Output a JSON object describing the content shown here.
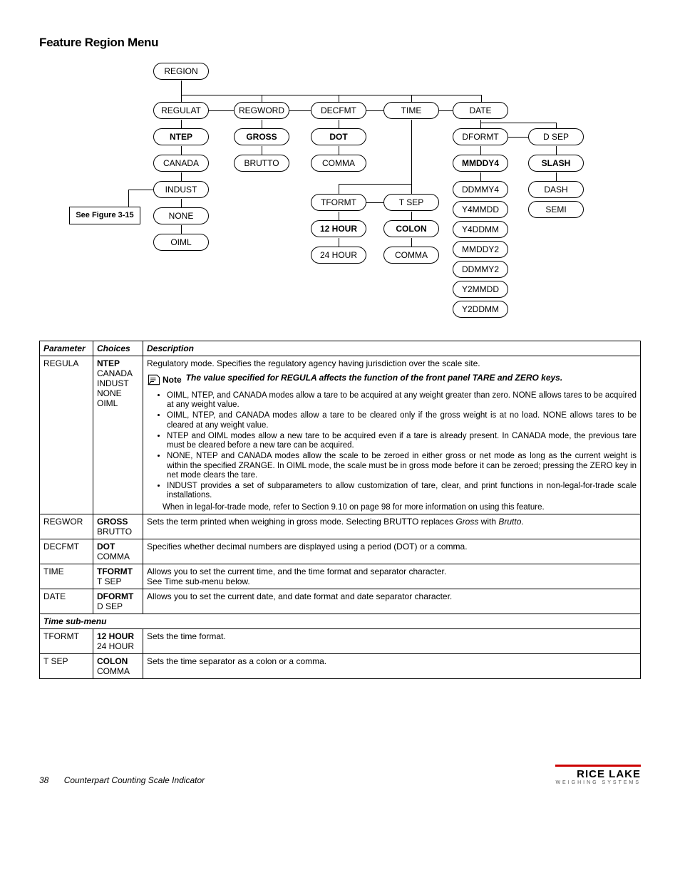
{
  "title": "Feature Region Menu",
  "figref": "See Figure 3-15",
  "diagram": {
    "root": "REGION",
    "row2": [
      "REGULAT",
      "REGWORD",
      "DECFMT",
      "TIME",
      "DATE"
    ],
    "regulat": {
      "sel": "NTEP",
      "opts": [
        "CANADA",
        "INDUST",
        "NONE",
        "OIML"
      ]
    },
    "regword": {
      "sel": "GROSS",
      "opts": [
        "BRUTTO"
      ]
    },
    "decfmt": {
      "sel": "DOT",
      "opts": [
        "COMMA"
      ]
    },
    "time_sub": {
      "t": "TFORMT",
      "s": "T SEP",
      "tformt": {
        "sel": "12 HOUR",
        "opts": [
          "24 HOUR"
        ]
      },
      "tsep": {
        "sel": "COLON",
        "opts": [
          "COMMA"
        ]
      }
    },
    "date_sub": {
      "d": "DFORMT",
      "s": "D SEP",
      "dformt": {
        "sel": "MMDDY4",
        "opts": [
          "DDMMY4",
          "Y4MMDD",
          "Y4DDMM",
          "MMDDY2",
          "DDMMY2",
          "Y2MMDD",
          "Y2DDMM"
        ]
      },
      "dsep": {
        "sel": "SLASH",
        "opts": [
          "DASH",
          "SEMI"
        ]
      }
    }
  },
  "table": {
    "headers": [
      "Parameter",
      "Choices",
      "Description"
    ],
    "rows": [
      {
        "param": "REGULA",
        "choices_bold": "NTEP",
        "choices": [
          "CANADA",
          "INDUST",
          "NONE",
          "OIML"
        ],
        "desc_lead": "Regulatory mode. Specifies the regulatory agency having jurisdiction over the scale site.",
        "note": "The value specified for REGULA affects the function of the front panel TARE and ZERO keys.",
        "bullets": [
          "OIML, NTEP, and CANADA modes allow a tare to be acquired at any weight greater than zero. NONE allows tares to be acquired at any weight value.",
          "OIML, NTEP, and CANADA modes allow a tare to be cleared only if the gross weight is at no load. NONE allows tares to be cleared at any weight value.",
          "NTEP and OIML modes allow a new tare to be acquired even if a tare is already present. In CANADA mode, the previous tare must be cleared before a new tare can be acquired.",
          "NONE, NTEP and CANADA modes allow the scale to be zeroed in either gross or net mode as long as the current weight is within the specified ZRANGE. In OIML mode, the scale must be in gross mode before it can be zeroed; pressing the ZERO key in net mode clears the tare.",
          "INDUST provides a set of subparameters to allow customization of tare, clear, and print functions in non-legal-for-trade scale installations."
        ],
        "after": "When in legal-for-trade mode, refer to Section 9.10 on page 98 for more information on using this feature."
      },
      {
        "param": "REGWOR",
        "choices_bold": "GROSS",
        "choices": [
          "BRUTTO"
        ],
        "desc": "Sets the term printed when weighing in gross mode. Selecting BRUTTO replaces Gross with Brutto."
      },
      {
        "param": "DECFMT",
        "choices_bold": "DOT",
        "choices": [
          "COMMA"
        ],
        "desc": "Specifies whether decimal numbers are displayed using a period (DOT) or a comma."
      },
      {
        "param": "TIME",
        "choices_bold": "TFORMT",
        "choices": [
          "T SEP"
        ],
        "desc": "Allows you to set the current time, and the time format and separator character.\nSee Time sub-menu below."
      },
      {
        "param": "DATE",
        "choices_bold": "DFORMT",
        "choices": [
          "D SEP"
        ],
        "desc": "Allows you to set the current date, and date format and date separator character."
      }
    ],
    "submenu_label": "Time sub-menu",
    "subrows": [
      {
        "param": "TFORMT",
        "choices_bold": "12 HOUR",
        "choices": [
          "24 HOUR"
        ],
        "desc": "Sets the time format."
      },
      {
        "param": "T SEP",
        "choices_bold": "COLON",
        "choices": [
          "COMMA"
        ],
        "desc": "Sets the time separator as a colon or a comma."
      }
    ]
  },
  "footer": {
    "page": "38",
    "doc": "Counterpart Counting Scale Indicator",
    "brand": "RICE LAKE",
    "tag": "WEIGHING SYSTEMS"
  },
  "note_label": "Note"
}
